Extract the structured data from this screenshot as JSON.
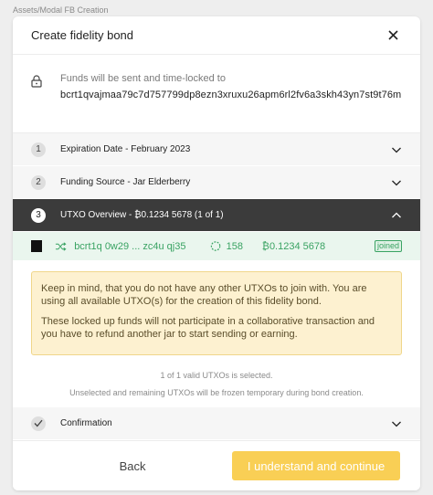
{
  "frame_label": "Assets/Modal FB Creation",
  "modal": {
    "title": "Create fidelity bond",
    "locked_label": "Funds will be sent and time-locked to",
    "locked_address": "bcrt1qvajmaa79c7d757799dp8ezn3xruxu26apm6rl2fv6a3skh43yn7st9t76m"
  },
  "steps": [
    {
      "number": "1",
      "label": "Expiration Date - February 2023"
    },
    {
      "number": "2",
      "label": "Funding Source - Jar Elderberry"
    },
    {
      "number": "3",
      "label": "UTXO Overview - ₿0.1234 5678 (1 of 1)"
    }
  ],
  "utxo": {
    "address": "bcrt1q 0w29 ... zc4u qj35",
    "confirmations": "158",
    "amount": "₿0.1234 5678",
    "badge": "joined",
    "color": "#3aa363"
  },
  "warning": {
    "paragraph1": "Keep in mind, that you do not have any other UTXOs to join with. You are using all available UTXO(s) for the creation of this fidelity bond.",
    "paragraph2": "These locked up funds will not participate in a collaborative transaction and you have to refund another jar to start sending or earning."
  },
  "selection_info": "1 of 1 valid UTXOs is selected.",
  "frozen_info": "Unselected and remaining UTXOs will be frozen temporary during bond creation.",
  "confirmation_step": {
    "label": "Confirmation"
  },
  "footer": {
    "back_label": "Back",
    "continue_label": "I understand and continue",
    "continue_color": "#f9cf55"
  }
}
